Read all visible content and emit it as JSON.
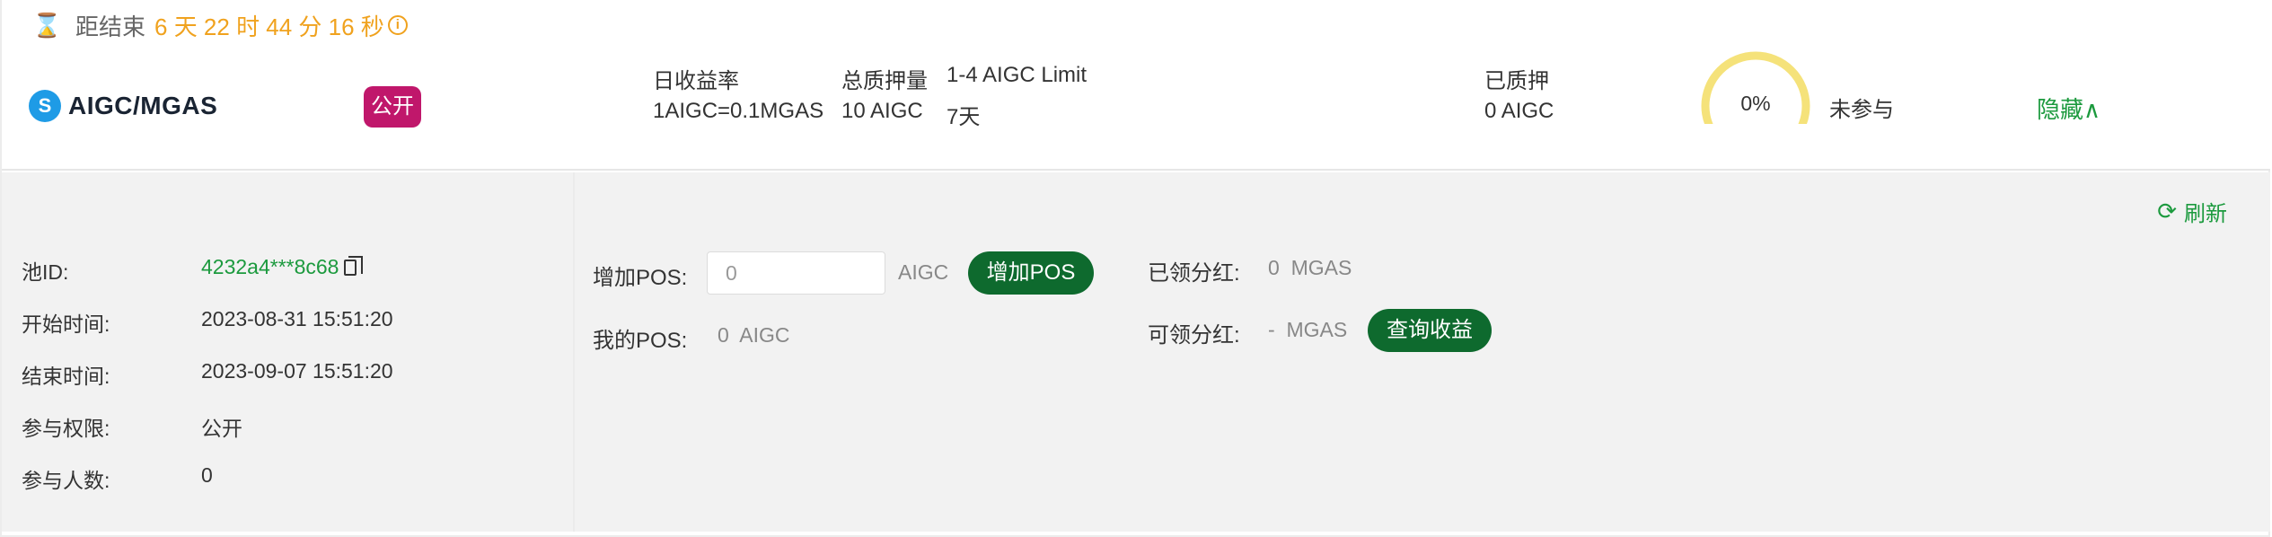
{
  "countdown": {
    "label": "距结束",
    "time": "6 天 22 时 44 分 16 秒"
  },
  "pool": {
    "token_icon_letter": "S",
    "name": "AIGC/MGAS",
    "visibility_badge": "公开",
    "yield_label": "日收益率",
    "yield_value": "1AIGC=0.1MGAS",
    "total_staked_label": "总质押量",
    "total_staked_value": "10 AIGC",
    "limit_label": "1-4 AIGC Limit",
    "duration_value": "7天",
    "staked_label": "已质押",
    "staked_value": "0 AIGC",
    "progress_text": "0%",
    "progress_fraction": 0,
    "participation_status": "未参与",
    "toggle_label": "隐藏∧"
  },
  "details": {
    "refresh_label": "刷新",
    "rows": [
      {
        "label": "池ID:",
        "value": "4232a4***8c68"
      },
      {
        "label": "开始时间:",
        "value": "2023-08-31 15:51:20"
      },
      {
        "label": "结束时间:",
        "value": "2023-09-07 15:51:20"
      },
      {
        "label": "参与权限:",
        "value": "公开"
      },
      {
        "label": "参与人数:",
        "value": "0"
      }
    ],
    "add_pos_label": "增加POS:",
    "add_pos_placeholder": "0",
    "add_pos_unit": "AIGC",
    "add_pos_button": "增加POS",
    "my_pos_label": "我的POS:",
    "my_pos_value": "0  AIGC",
    "claimed_label": "已领分红:",
    "claimed_value": "0  MGAS",
    "claimable_label": "可领分红:",
    "claimable_value": "-  MGAS",
    "query_button": "查询收益"
  },
  "colors": {
    "accent_green": "#1c9a3e",
    "button_green": "#0e6a2e",
    "countdown_orange": "#f0a21e",
    "badge_magenta": "#c0176b",
    "ring_yellow": "#f5e27a"
  }
}
